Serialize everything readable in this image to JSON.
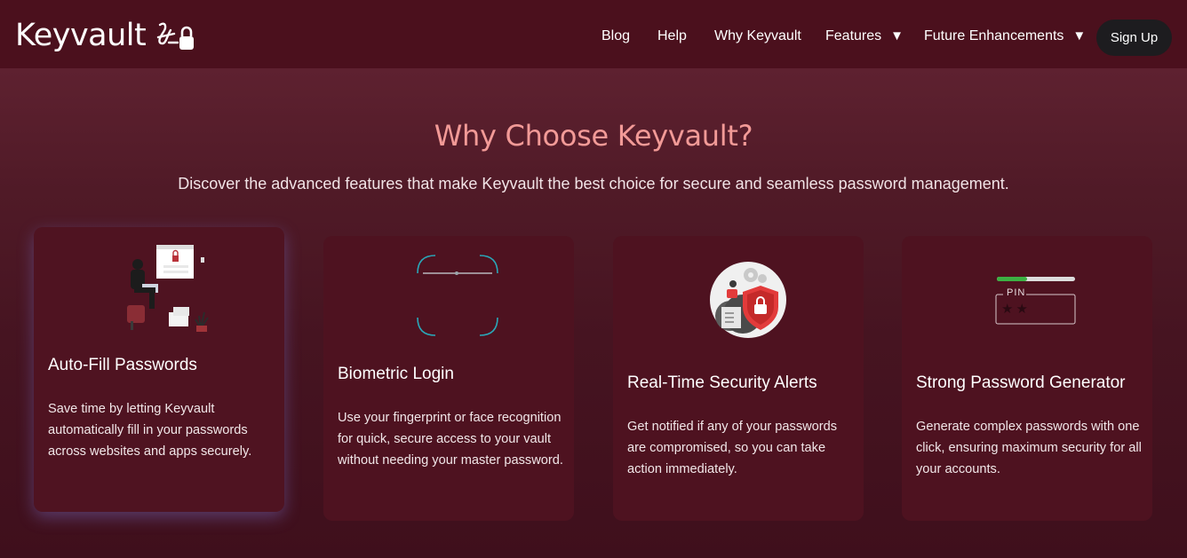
{
  "nav": {
    "logo_text": "Keyvault",
    "links": [
      "Blog",
      "Help",
      "Why Keyvault"
    ],
    "dropdowns": [
      "Features",
      "Future Enhancements"
    ],
    "caret": "▼",
    "signup_label": "Sign Up"
  },
  "hero": {
    "title": "Why Choose Keyvault?",
    "subtitle": "Discover the advanced features that make Keyvault the best choice for secure and seamless password management."
  },
  "cards": [
    {
      "title": "Auto-Fill Passwords",
      "text": "Save time by letting Keyvault automatically fill in your passwords across websites and apps securely.",
      "icon": "person-laptop-lock-illustration"
    },
    {
      "title": "Biometric Login",
      "text": "Use your fingerprint or face recognition for quick, secure access to your vault without needing your master password.",
      "icon": "face-scan-frame-icon"
    },
    {
      "title": "Real-Time Security Alerts",
      "text": "Get notified if any of your passwords are compromised, so you can take action immediately.",
      "icon": "security-shield-alert-illustration"
    },
    {
      "title": "Strong Password Generator",
      "text": "Generate complex passwords with one click, ensuring maximum security for all your accounts.",
      "icon": "pin-strength-meter-icon",
      "pin_label": "PIN",
      "pin_value": "★★"
    }
  ],
  "colors": {
    "nav_bg": "#4b101d",
    "title": "#f29a97",
    "card_bg": "#4e1220",
    "signup_bg": "#1d1c1f",
    "accent_teal": "#2aa7b8",
    "accent_red": "#e23b3b"
  }
}
